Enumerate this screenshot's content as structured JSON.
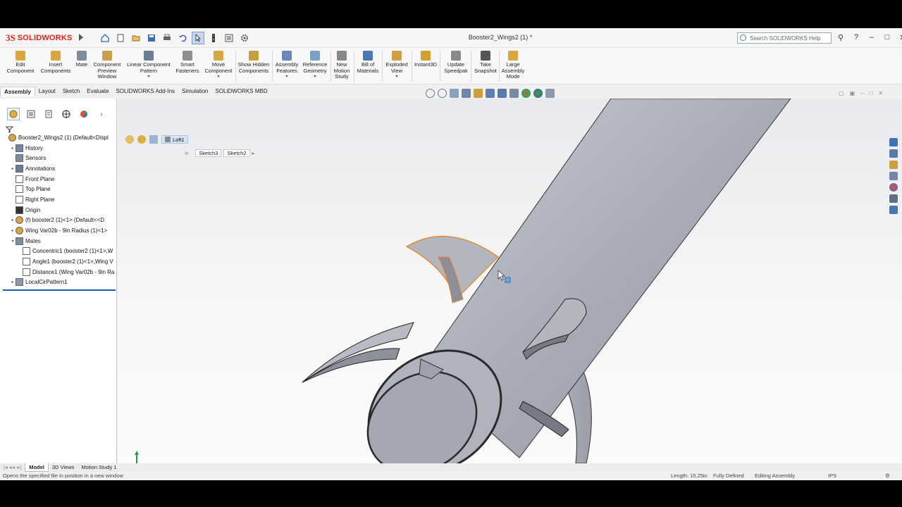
{
  "app": {
    "logo_ds": "3S",
    "logo_text": "SOLIDWORKS"
  },
  "window": {
    "title": "Booster2_Wings2 (1) *"
  },
  "search": {
    "placeholder": "Search SOLIDWORKS Help"
  },
  "commands": [
    {
      "label": "Edit Component",
      "icon": "edit-component-icon",
      "color": "#d9a640"
    },
    {
      "label": "Insert Components",
      "icon": "insert-components-icon",
      "color": "#d9a640"
    },
    {
      "label": "Mate",
      "icon": "mate-icon",
      "color": "#7e8a9e"
    },
    {
      "label": "Component Preview Window",
      "icon": "preview-window-icon",
      "color": "#c9a04a"
    },
    {
      "label": "Linear Component Pattern",
      "icon": "linear-pattern-icon",
      "color": "#6b7c96"
    },
    {
      "label": "Smart Fasteners",
      "icon": "smart-fasteners-icon",
      "color": "#8f8f8f"
    },
    {
      "label": "Move Component",
      "icon": "move-component-icon",
      "color": "#d9a640"
    },
    {
      "label": "Show Hidden Components",
      "icon": "show-hidden-icon",
      "color": "#c8a040"
    },
    {
      "label": "Assembly Features",
      "icon": "assembly-features-icon",
      "color": "#6a89b8"
    },
    {
      "label": "Reference Geometry",
      "icon": "reference-geometry-icon",
      "color": "#7aa0c8"
    },
    {
      "label": "New Motion Study",
      "icon": "motion-study-icon",
      "color": "#888888"
    },
    {
      "label": "Bill of Materials",
      "icon": "bom-icon",
      "color": "#4a78b0"
    },
    {
      "label": "Exploded View",
      "icon": "exploded-view-icon",
      "color": "#cfa040"
    },
    {
      "label": "Instant3D",
      "icon": "instant3d-icon",
      "color": "#d0a030"
    },
    {
      "label": "Update Speedpak",
      "icon": "speedpak-icon",
      "color": "#8a8a8a"
    },
    {
      "label": "Take Snapshot",
      "icon": "snapshot-icon",
      "color": "#555555"
    },
    {
      "label": "Large Assembly Mode",
      "icon": "large-assembly-icon",
      "color": "#d9a640"
    }
  ],
  "tabs": [
    "Assembly",
    "Layout",
    "Sketch",
    "Evaluate",
    "SOLIDWORKS Add-Ins",
    "Simulation",
    "SOLIDWORKS MBD"
  ],
  "breadcrumb": {
    "feature": "Loft1",
    "sketches": [
      "Sketch3",
      "Sketch2"
    ]
  },
  "tree": [
    {
      "label": "Booster2_Wings2 (1)  (Default<Displ",
      "icon": "assembly-icon",
      "expander": "",
      "indent": 0
    },
    {
      "label": "History",
      "icon": "history-icon",
      "expander": "▸",
      "indent": 1
    },
    {
      "label": "Sensors",
      "icon": "sensors-icon",
      "expander": "",
      "indent": 1
    },
    {
      "label": "Annotations",
      "icon": "annotations-icon",
      "expander": "▸",
      "indent": 1
    },
    {
      "label": "Front Plane",
      "icon": "plane-icon",
      "expander": "",
      "indent": 1
    },
    {
      "label": "Top Plane",
      "icon": "plane-icon",
      "expander": "",
      "indent": 1
    },
    {
      "label": "Right Plane",
      "icon": "plane-icon",
      "expander": "",
      "indent": 1
    },
    {
      "label": "Origin",
      "icon": "origin-icon",
      "expander": "",
      "indent": 1
    },
    {
      "label": "(f) booster2 (1)<1> (Default<<D",
      "icon": "part-icon",
      "expander": "▸",
      "indent": 1
    },
    {
      "label": "Wing Var02b - 9in Radius (1)<1>",
      "icon": "part-icon",
      "expander": "▸",
      "indent": 1
    },
    {
      "label": "Mates",
      "icon": "mates-icon",
      "expander": "▾",
      "indent": 1
    },
    {
      "label": "Concentric1 (booster2 (1)<1>,W",
      "icon": "concentric-icon",
      "expander": "",
      "indent": 2
    },
    {
      "label": "Angle1 (booster2 (1)<1>,Wing V",
      "icon": "angle-icon",
      "expander": "",
      "indent": 2
    },
    {
      "label": "Distance1 (Wing Var02b - 9in Ra",
      "icon": "distance-icon",
      "expander": "",
      "indent": 2
    },
    {
      "label": "LocalCirPattern1",
      "icon": "pattern-icon",
      "expander": "▸",
      "indent": 1
    }
  ],
  "bottom_tabs": [
    "Model",
    "3D Views",
    "Motion Study 1"
  ],
  "status": {
    "message": "Opens the specified file in position in a new window",
    "length": "Length: 15.25in",
    "defined": "Fully Defined",
    "mode": "Editing Assembly",
    "units": "IPS"
  },
  "colors": {
    "accent": "#1a5fb4",
    "selection": "#e8862a",
    "model": "#a9abb6"
  }
}
